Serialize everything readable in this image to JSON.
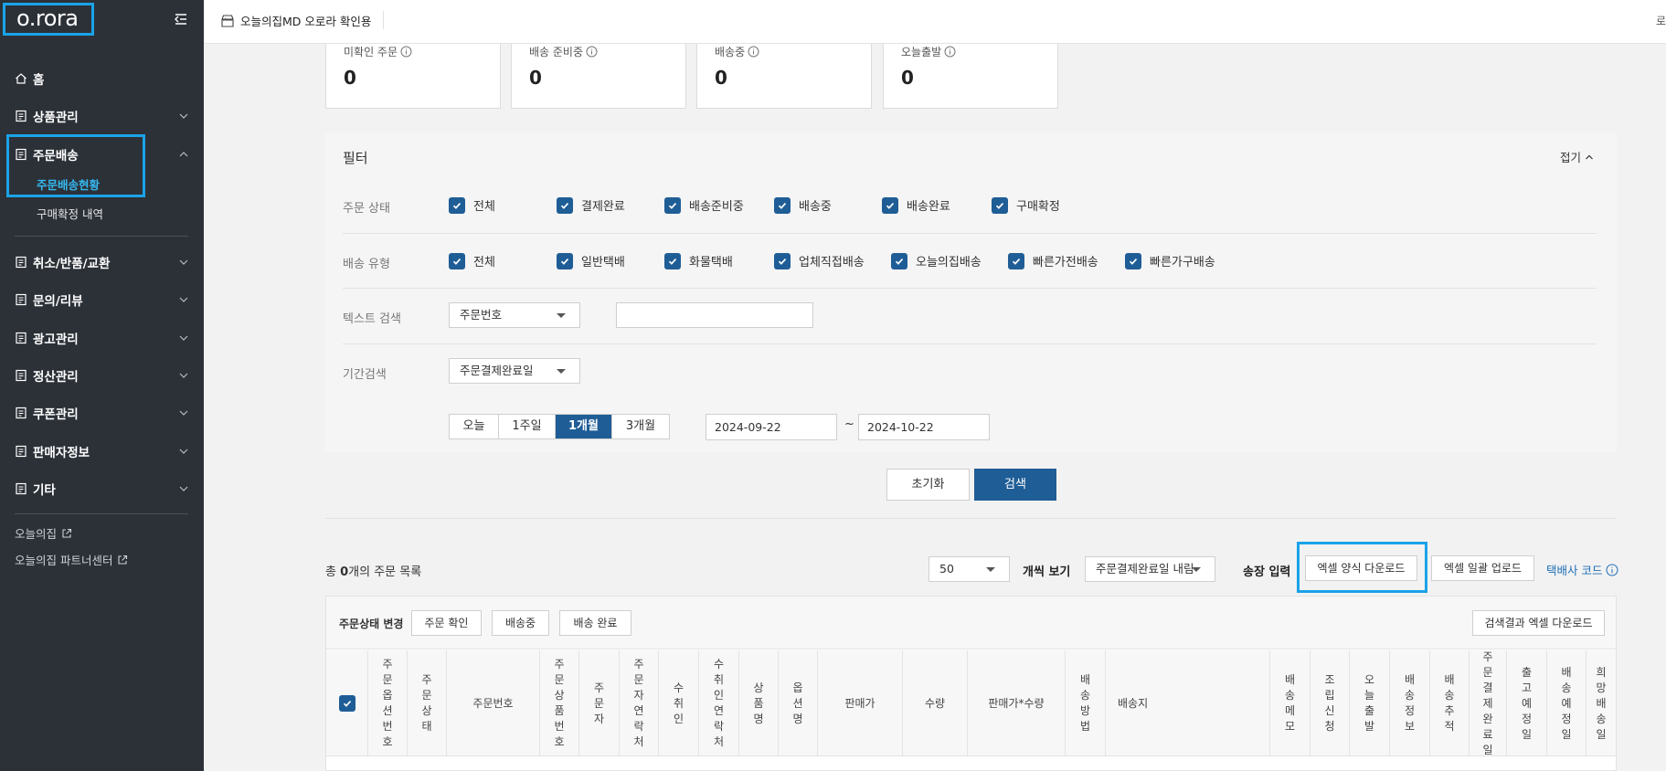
{
  "app": {
    "logo": "o.rora",
    "store_name": "오늘의집MD 오로라 확인용",
    "top_right": "로"
  },
  "sidebar": {
    "items": [
      {
        "label": "홈",
        "icon": "home-icon"
      },
      {
        "label": "상품관리",
        "icon": "doc-icon"
      },
      {
        "label": "주문배송",
        "icon": "doc-icon"
      },
      {
        "label": "취소/반품/교환",
        "icon": "doc-icon"
      },
      {
        "label": "문의/리뷰",
        "icon": "doc-icon"
      },
      {
        "label": "광고관리",
        "icon": "doc-icon"
      },
      {
        "label": "정산관리",
        "icon": "doc-icon"
      },
      {
        "label": "쿠폰관리",
        "icon": "doc-icon"
      },
      {
        "label": "판매자정보",
        "icon": "doc-icon"
      },
      {
        "label": "기타",
        "icon": "doc-icon"
      }
    ],
    "sub_items": [
      "주문배송현황",
      "구매확정 내역"
    ],
    "links": [
      "오늘의집",
      "오늘의집 파트너센터"
    ]
  },
  "stats": [
    {
      "label": "미확인 주문",
      "value": "0"
    },
    {
      "label": "배송 준비중",
      "value": "0"
    },
    {
      "label": "배송중",
      "value": "0"
    },
    {
      "label": "오늘출발",
      "value": "0"
    }
  ],
  "filter": {
    "title": "필터",
    "fold": "접기",
    "order_status_label": "주문 상태",
    "order_status": [
      "전체",
      "결제완료",
      "배송준비중",
      "배송중",
      "배송완료",
      "구매확정"
    ],
    "ship_type_label": "배송 유형",
    "ship_type": [
      "전체",
      "일반택배",
      "화물택배",
      "업체직접배송",
      "오늘의집배송",
      "빠른가전배송",
      "빠른가구배송"
    ],
    "text_search_label": "텍스트 검색",
    "text_search_select": "주문번호",
    "text_search_value": "",
    "period_label": "기간검색",
    "period_select": "주문결제완료일",
    "periods": [
      "오늘",
      "1주일",
      "1개월",
      "3개월"
    ],
    "period_selected": "1개월",
    "date_from": "2024-09-22",
    "date_tilde": "~",
    "date_to": "2024-10-22"
  },
  "actions": {
    "reset": "초기화",
    "search": "검색"
  },
  "list": {
    "total_prefix": "총 ",
    "total_count": "0",
    "total_suffix": "개의 주문 목록",
    "page_size": "50",
    "view_label": "개씩 보기",
    "sort_select": "주문결제완료일 내림",
    "invoice_label": "송장 입력",
    "excel_template": "엑셀 양식 다운로드",
    "excel_upload": "엑셀 일괄 업로드",
    "courier_code": "택배사 코드"
  },
  "table": {
    "status_change_label": "주문상태 변경",
    "status_buttons": [
      "주문 확인",
      "배송중",
      "배송 완료"
    ],
    "excel_download": "검색결과 엑셀 다운로드",
    "columns": [
      "주문옵션번호",
      "주문상태",
      "주문번호",
      "주문상품번호",
      "주문자",
      "주문자연락처",
      "수취인",
      "수취인연락처",
      "상품명",
      "옵션명",
      "판매가",
      "수량",
      "판매가*수량",
      "배송방법",
      "배송지",
      "배송메모",
      "조립신청",
      "오늘출발",
      "배송정보",
      "배송추적",
      "주문결제완료일",
      "출고예정일",
      "배송예정일",
      "희망배송일"
    ]
  },
  "colors": {
    "sidebar_bg": "#2c3138",
    "primary": "#1f5d96",
    "highlight": "#1aa3e8",
    "active_sub": "#35b9f0"
  }
}
